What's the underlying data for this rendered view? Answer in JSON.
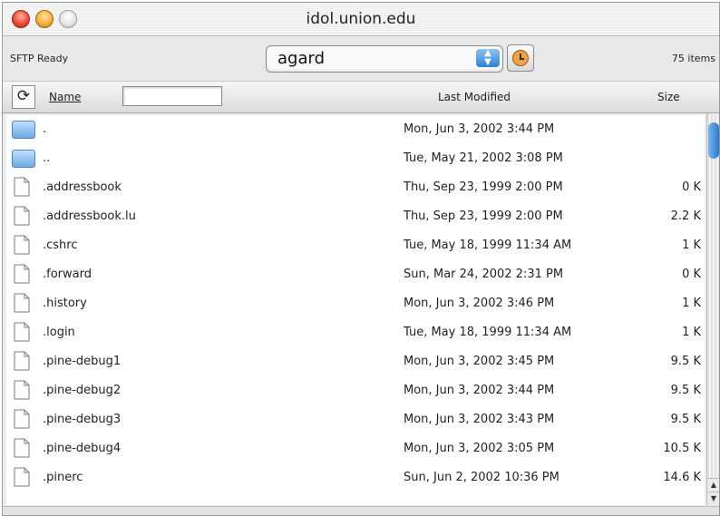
{
  "window": {
    "title": "idol.union.edu"
  },
  "toolbar": {
    "status": "SFTP Ready",
    "directory": "agard",
    "item_count": "75 items"
  },
  "header": {
    "name_label": "Name",
    "modified_label": "Last Modified",
    "size_label": "Size",
    "filter_value": ""
  },
  "files": [
    {
      "name": ".",
      "modified": "Mon, Jun 3, 2002 3:44 PM",
      "size": "",
      "type": "folder"
    },
    {
      "name": "..",
      "modified": "Tue, May 21, 2002 3:08 PM",
      "size": "",
      "type": "folder"
    },
    {
      "name": ".addressbook",
      "modified": "Thu, Sep 23, 1999 2:00 PM",
      "size": "0 K",
      "type": "file"
    },
    {
      "name": ".addressbook.lu",
      "modified": "Thu, Sep 23, 1999 2:00 PM",
      "size": "2.2 K",
      "type": "file"
    },
    {
      "name": ".cshrc",
      "modified": "Tue, May 18, 1999 11:34 AM",
      "size": "1 K",
      "type": "file"
    },
    {
      "name": ".forward",
      "modified": "Sun, Mar 24, 2002 2:31 PM",
      "size": "0 K",
      "type": "file"
    },
    {
      "name": ".history",
      "modified": "Mon, Jun 3, 2002 3:46 PM",
      "size": "1 K",
      "type": "file"
    },
    {
      "name": ".login",
      "modified": "Tue, May 18, 1999 11:34 AM",
      "size": "1 K",
      "type": "file"
    },
    {
      "name": ".pine-debug1",
      "modified": "Mon, Jun 3, 2002 3:45 PM",
      "size": "9.5 K",
      "type": "file"
    },
    {
      "name": ".pine-debug2",
      "modified": "Mon, Jun 3, 2002 3:44 PM",
      "size": "9.5 K",
      "type": "file"
    },
    {
      "name": ".pine-debug3",
      "modified": "Mon, Jun 3, 2002 3:43 PM",
      "size": "9.5 K",
      "type": "file"
    },
    {
      "name": ".pine-debug4",
      "modified": "Mon, Jun 3, 2002 3:05 PM",
      "size": "10.5 K",
      "type": "file"
    },
    {
      "name": ".pinerc",
      "modified": "Sun, Jun 2, 2002 10:36 PM",
      "size": "14.6 K",
      "type": "file"
    }
  ]
}
